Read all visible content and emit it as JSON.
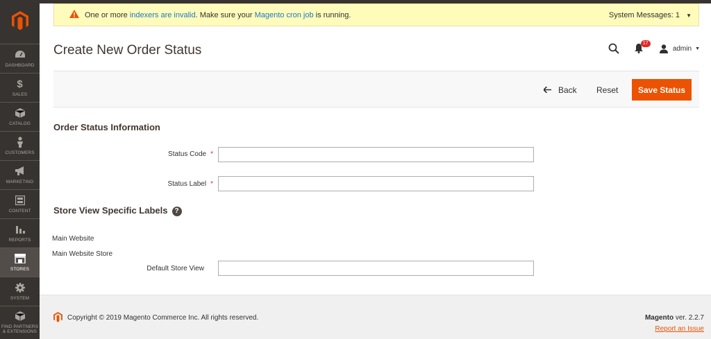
{
  "sidebar": {
    "items": [
      {
        "label": "DASHBOARD",
        "icon": "dashboard-icon"
      },
      {
        "label": "SALES",
        "icon": "dollar-icon"
      },
      {
        "label": "CATALOG",
        "icon": "box-icon"
      },
      {
        "label": "CUSTOMERS",
        "icon": "person-icon"
      },
      {
        "label": "MARKETING",
        "icon": "megaphone-icon"
      },
      {
        "label": "CONTENT",
        "icon": "layout-icon"
      },
      {
        "label": "REPORTS",
        "icon": "bar-chart-icon"
      },
      {
        "label": "STORES",
        "icon": "store-icon"
      },
      {
        "label": "SYSTEM",
        "icon": "gear-icon"
      },
      {
        "label_line1": "FIND PARTNERS",
        "label_line2": "& EXTENSIONS",
        "icon": "cube-icon"
      }
    ]
  },
  "system_message": {
    "text_before": "One or more ",
    "link1": "indexers are invalid",
    "text_middle": ". Make sure your ",
    "link2": "Magento cron job",
    "text_after": " is running.",
    "count_label": "System Messages: 1"
  },
  "page": {
    "title": "Create New Order Status"
  },
  "header": {
    "notification_count": "17",
    "user": "admin"
  },
  "actions": {
    "back": "Back",
    "reset": "Reset",
    "save": "Save Status"
  },
  "form": {
    "section1": "Order Status Information",
    "status_code_label": "Status Code",
    "status_code_value": "",
    "status_label_label": "Status Label",
    "status_label_value": "",
    "section2": "Store View Specific Labels",
    "help": "?",
    "website": "Main Website",
    "store": "Main Website Store",
    "store_view_label": "Default Store View",
    "store_view_value": "",
    "required_mark": "*"
  },
  "footer": {
    "copyright": "Copyright © 2019 Magento Commerce Inc. All rights reserved.",
    "brand": "Magento",
    "version": " ver. 2.2.7",
    "report": "Report an Issue"
  },
  "colors": {
    "accent": "#eb5202",
    "sidebar": "#373330",
    "link": "#1979c3"
  }
}
